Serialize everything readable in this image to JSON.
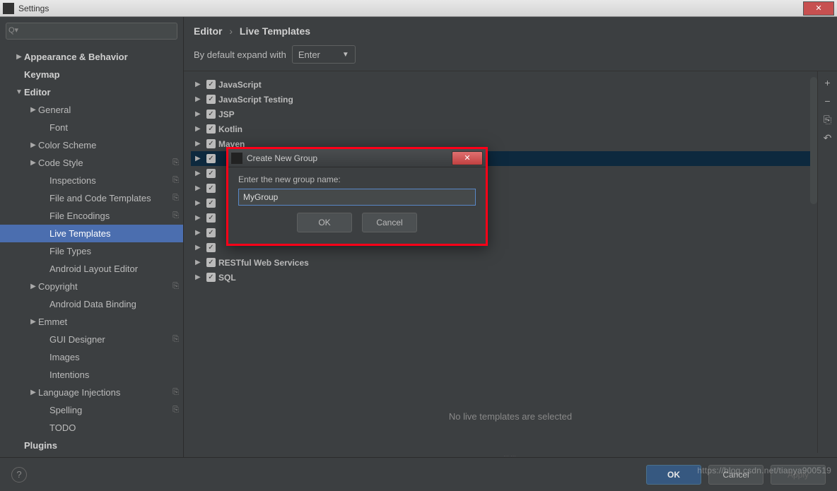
{
  "window": {
    "title": "Settings"
  },
  "search": {
    "placeholder": ""
  },
  "sidebar": {
    "items": [
      {
        "label": "Appearance & Behavior",
        "arrow": "▶",
        "indent": 1,
        "bold": true
      },
      {
        "label": "Keymap",
        "arrow": "",
        "indent": 1,
        "bold": true
      },
      {
        "label": "Editor",
        "arrow": "▼",
        "indent": 1,
        "bold": true
      },
      {
        "label": "General",
        "arrow": "▶",
        "indent": 2,
        "bold": false
      },
      {
        "label": "Font",
        "arrow": "",
        "indent": 3,
        "bold": false
      },
      {
        "label": "Color Scheme",
        "arrow": "▶",
        "indent": 2,
        "bold": false
      },
      {
        "label": "Code Style",
        "arrow": "▶",
        "indent": 2,
        "bold": false,
        "copy": true
      },
      {
        "label": "Inspections",
        "arrow": "",
        "indent": 3,
        "bold": false,
        "copy": true
      },
      {
        "label": "File and Code Templates",
        "arrow": "",
        "indent": 3,
        "bold": false,
        "copy": true
      },
      {
        "label": "File Encodings",
        "arrow": "",
        "indent": 3,
        "bold": false,
        "copy": true
      },
      {
        "label": "Live Templates",
        "arrow": "",
        "indent": 3,
        "bold": false,
        "selected": true
      },
      {
        "label": "File Types",
        "arrow": "",
        "indent": 3,
        "bold": false
      },
      {
        "label": "Android Layout Editor",
        "arrow": "",
        "indent": 3,
        "bold": false
      },
      {
        "label": "Copyright",
        "arrow": "▶",
        "indent": 2,
        "bold": false,
        "copy": true
      },
      {
        "label": "Android Data Binding",
        "arrow": "",
        "indent": 3,
        "bold": false
      },
      {
        "label": "Emmet",
        "arrow": "▶",
        "indent": 2,
        "bold": false
      },
      {
        "label": "GUI Designer",
        "arrow": "",
        "indent": 3,
        "bold": false,
        "copy": true
      },
      {
        "label": "Images",
        "arrow": "",
        "indent": 3,
        "bold": false
      },
      {
        "label": "Intentions",
        "arrow": "",
        "indent": 3,
        "bold": false
      },
      {
        "label": "Language Injections",
        "arrow": "▶",
        "indent": 2,
        "bold": false,
        "copy": true
      },
      {
        "label": "Spelling",
        "arrow": "",
        "indent": 3,
        "bold": false,
        "copy": true
      },
      {
        "label": "TODO",
        "arrow": "",
        "indent": 3,
        "bold": false
      },
      {
        "label": "Plugins",
        "arrow": "",
        "indent": 1,
        "bold": true
      }
    ]
  },
  "breadcrumb": {
    "a": "Editor",
    "b": "Live Templates"
  },
  "expand": {
    "label": "By default expand with",
    "value": "Enter"
  },
  "templates": [
    {
      "label": "JavaScript",
      "highlight": false
    },
    {
      "label": "JavaScript Testing",
      "highlight": false
    },
    {
      "label": "JSP",
      "highlight": false
    },
    {
      "label": "Kotlin",
      "highlight": false
    },
    {
      "label": "Maven",
      "highlight": false
    },
    {
      "label": "",
      "highlight": true
    },
    {
      "label": "",
      "highlight": false
    },
    {
      "label": "",
      "highlight": false
    },
    {
      "label": "",
      "highlight": false
    },
    {
      "label": "",
      "highlight": false
    },
    {
      "label": "",
      "highlight": false
    },
    {
      "label": "",
      "highlight": false
    },
    {
      "label": "RESTful Web Services",
      "highlight": false
    },
    {
      "label": "SQL",
      "highlight": false
    }
  ],
  "tools": {
    "add": "+",
    "remove": "−",
    "duplicate": "⎘",
    "restore": "↶"
  },
  "hint": "No live templates are selected",
  "dialog": {
    "title": "Create New Group",
    "prompt": "Enter the new group name:",
    "value": "MyGroup",
    "ok": "OK",
    "cancel": "Cancel"
  },
  "footer": {
    "ok": "OK",
    "cancel": "Cancel",
    "apply": "Apply"
  },
  "watermark": "https://blog.csdn.net/tianya900519"
}
